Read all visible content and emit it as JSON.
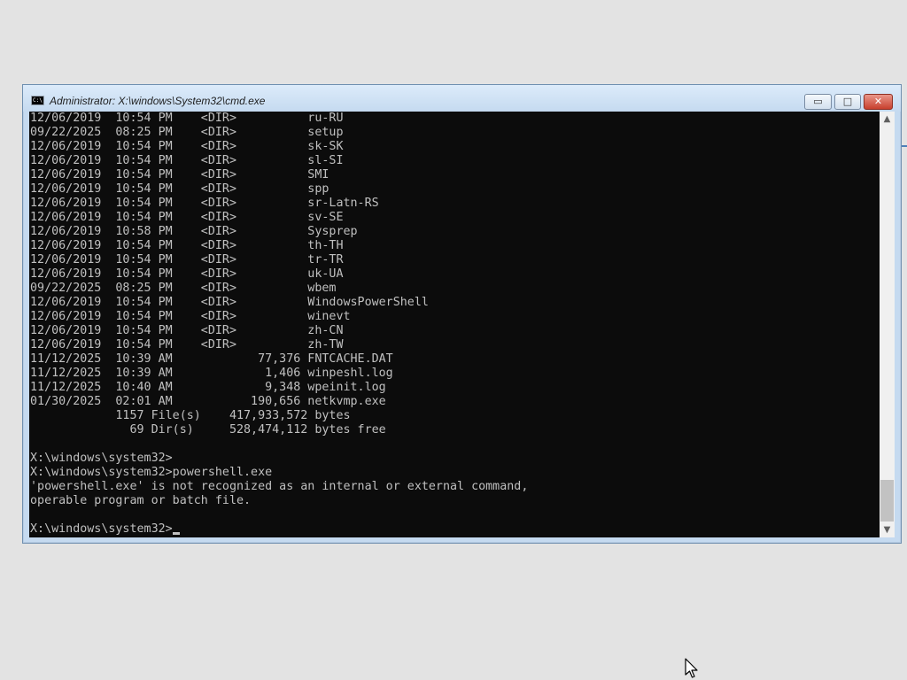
{
  "window": {
    "title": "Administrator: X:\\windows\\System32\\cmd.exe",
    "icon": "cmd-icon",
    "icon_text": "C:\\",
    "minimize_glyph": "▭",
    "maximize_glyph": "□",
    "close_glyph": "✕"
  },
  "console": {
    "lines": [
      "12/06/2019  10:54 PM    <DIR>          ru-RU",
      "09/22/2025  08:25 PM    <DIR>          setup",
      "12/06/2019  10:54 PM    <DIR>          sk-SK",
      "12/06/2019  10:54 PM    <DIR>          sl-SI",
      "12/06/2019  10:54 PM    <DIR>          SMI",
      "12/06/2019  10:54 PM    <DIR>          spp",
      "12/06/2019  10:54 PM    <DIR>          sr-Latn-RS",
      "12/06/2019  10:54 PM    <DIR>          sv-SE",
      "12/06/2019  10:58 PM    <DIR>          Sysprep",
      "12/06/2019  10:54 PM    <DIR>          th-TH",
      "12/06/2019  10:54 PM    <DIR>          tr-TR",
      "12/06/2019  10:54 PM    <DIR>          uk-UA",
      "09/22/2025  08:25 PM    <DIR>          wbem",
      "12/06/2019  10:54 PM    <DIR>          WindowsPowerShell",
      "12/06/2019  10:54 PM    <DIR>          winevt",
      "12/06/2019  10:54 PM    <DIR>          zh-CN",
      "12/06/2019  10:54 PM    <DIR>          zh-TW",
      "11/12/2025  10:39 AM            77,376 FNTCACHE.DAT",
      "11/12/2025  10:39 AM             1,406 winpeshl.log",
      "11/12/2025  10:40 AM             9,348 wpeinit.log",
      "01/30/2025  02:01 AM           190,656 netkvmp.exe",
      "            1157 File(s)    417,933,572 bytes",
      "              69 Dir(s)     528,474,112 bytes free",
      "",
      "X:\\windows\\system32>",
      "X:\\windows\\system32>powershell.exe",
      "'powershell.exe' is not recognized as an internal or external command,",
      "operable program or batch file.",
      ""
    ],
    "prompt": "X:\\windows\\system32>"
  },
  "scrollbar": {
    "up_glyph": "▲",
    "down_glyph": "▼",
    "position": 0.92
  },
  "pointer": {
    "icon": "mouse-pointer-icon"
  }
}
